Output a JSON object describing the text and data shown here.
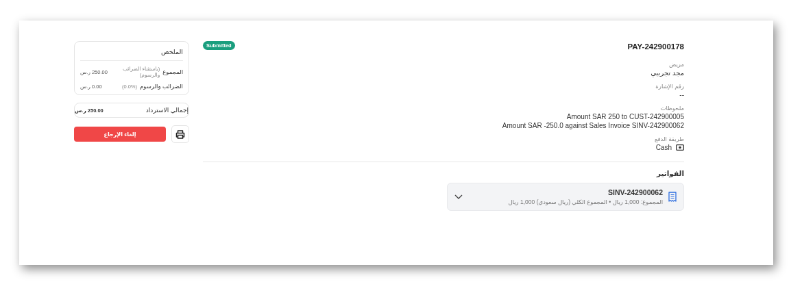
{
  "header": {
    "title": "PAY-242900178",
    "status": "Submitted"
  },
  "fields": [
    {
      "kind": "text",
      "label": "مريض",
      "value": "مجد تجريبي"
    },
    {
      "kind": "text",
      "label": "رقم الإشارة",
      "value": "--"
    },
    {
      "kind": "lines",
      "label": "ملحوظات",
      "lines": [
        "Amount SAR 250 to CUST-242900005",
        "Amount SAR -250.0 against Sales Invoice SINV-242900062"
      ]
    },
    {
      "kind": "payment",
      "label": "طريقة الدفع",
      "value": "Cash"
    }
  ],
  "invoices": {
    "title": "الفواتير",
    "items": [
      {
        "number": "SINV-242900062",
        "summary": "المجموع: 1,000 ريال • المجموع الكلي (ريال سعودي) 1,000 ريال",
        "expanded": false
      }
    ]
  },
  "summary": {
    "title": "الملخص",
    "rows": [
      {
        "label": "المجموع",
        "note": "(باستثناء الضرائب والرسوم)",
        "value": "250.00 ر.س"
      },
      {
        "label": "الضرائب والرسوم",
        "note": "(0.0%)",
        "value": "0.00 ر.س"
      }
    ]
  },
  "refund_total": {
    "label": "إجمالي الاسترداد",
    "value": "250.00 ر.س"
  },
  "actions": {
    "cancel_button": "إلغاء الإرجاع"
  }
}
